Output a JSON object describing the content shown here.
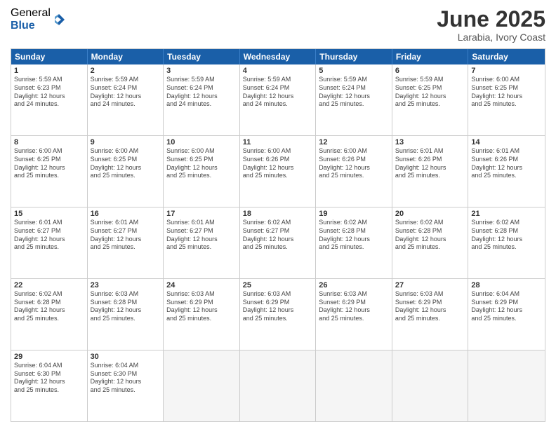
{
  "logo": {
    "general": "General",
    "blue": "Blue"
  },
  "title": "June 2025",
  "location": "Larabia, Ivory Coast",
  "days": [
    "Sunday",
    "Monday",
    "Tuesday",
    "Wednesday",
    "Thursday",
    "Friday",
    "Saturday"
  ],
  "rows": [
    [
      {
        "day": "1",
        "info": "Sunrise: 5:59 AM\nSunset: 6:23 PM\nDaylight: 12 hours\nand 24 minutes."
      },
      {
        "day": "2",
        "info": "Sunrise: 5:59 AM\nSunset: 6:24 PM\nDaylight: 12 hours\nand 24 minutes."
      },
      {
        "day": "3",
        "info": "Sunrise: 5:59 AM\nSunset: 6:24 PM\nDaylight: 12 hours\nand 24 minutes."
      },
      {
        "day": "4",
        "info": "Sunrise: 5:59 AM\nSunset: 6:24 PM\nDaylight: 12 hours\nand 24 minutes."
      },
      {
        "day": "5",
        "info": "Sunrise: 5:59 AM\nSunset: 6:24 PM\nDaylight: 12 hours\nand 25 minutes."
      },
      {
        "day": "6",
        "info": "Sunrise: 5:59 AM\nSunset: 6:25 PM\nDaylight: 12 hours\nand 25 minutes."
      },
      {
        "day": "7",
        "info": "Sunrise: 6:00 AM\nSunset: 6:25 PM\nDaylight: 12 hours\nand 25 minutes."
      }
    ],
    [
      {
        "day": "8",
        "info": "Sunrise: 6:00 AM\nSunset: 6:25 PM\nDaylight: 12 hours\nand 25 minutes."
      },
      {
        "day": "9",
        "info": "Sunrise: 6:00 AM\nSunset: 6:25 PM\nDaylight: 12 hours\nand 25 minutes."
      },
      {
        "day": "10",
        "info": "Sunrise: 6:00 AM\nSunset: 6:25 PM\nDaylight: 12 hours\nand 25 minutes."
      },
      {
        "day": "11",
        "info": "Sunrise: 6:00 AM\nSunset: 6:26 PM\nDaylight: 12 hours\nand 25 minutes."
      },
      {
        "day": "12",
        "info": "Sunrise: 6:00 AM\nSunset: 6:26 PM\nDaylight: 12 hours\nand 25 minutes."
      },
      {
        "day": "13",
        "info": "Sunrise: 6:01 AM\nSunset: 6:26 PM\nDaylight: 12 hours\nand 25 minutes."
      },
      {
        "day": "14",
        "info": "Sunrise: 6:01 AM\nSunset: 6:26 PM\nDaylight: 12 hours\nand 25 minutes."
      }
    ],
    [
      {
        "day": "15",
        "info": "Sunrise: 6:01 AM\nSunset: 6:27 PM\nDaylight: 12 hours\nand 25 minutes."
      },
      {
        "day": "16",
        "info": "Sunrise: 6:01 AM\nSunset: 6:27 PM\nDaylight: 12 hours\nand 25 minutes."
      },
      {
        "day": "17",
        "info": "Sunrise: 6:01 AM\nSunset: 6:27 PM\nDaylight: 12 hours\nand 25 minutes."
      },
      {
        "day": "18",
        "info": "Sunrise: 6:02 AM\nSunset: 6:27 PM\nDaylight: 12 hours\nand 25 minutes."
      },
      {
        "day": "19",
        "info": "Sunrise: 6:02 AM\nSunset: 6:28 PM\nDaylight: 12 hours\nand 25 minutes."
      },
      {
        "day": "20",
        "info": "Sunrise: 6:02 AM\nSunset: 6:28 PM\nDaylight: 12 hours\nand 25 minutes."
      },
      {
        "day": "21",
        "info": "Sunrise: 6:02 AM\nSunset: 6:28 PM\nDaylight: 12 hours\nand 25 minutes."
      }
    ],
    [
      {
        "day": "22",
        "info": "Sunrise: 6:02 AM\nSunset: 6:28 PM\nDaylight: 12 hours\nand 25 minutes."
      },
      {
        "day": "23",
        "info": "Sunrise: 6:03 AM\nSunset: 6:28 PM\nDaylight: 12 hours\nand 25 minutes."
      },
      {
        "day": "24",
        "info": "Sunrise: 6:03 AM\nSunset: 6:29 PM\nDaylight: 12 hours\nand 25 minutes."
      },
      {
        "day": "25",
        "info": "Sunrise: 6:03 AM\nSunset: 6:29 PM\nDaylight: 12 hours\nand 25 minutes."
      },
      {
        "day": "26",
        "info": "Sunrise: 6:03 AM\nSunset: 6:29 PM\nDaylight: 12 hours\nand 25 minutes."
      },
      {
        "day": "27",
        "info": "Sunrise: 6:03 AM\nSunset: 6:29 PM\nDaylight: 12 hours\nand 25 minutes."
      },
      {
        "day": "28",
        "info": "Sunrise: 6:04 AM\nSunset: 6:29 PM\nDaylight: 12 hours\nand 25 minutes."
      }
    ],
    [
      {
        "day": "29",
        "info": "Sunrise: 6:04 AM\nSunset: 6:30 PM\nDaylight: 12 hours\nand 25 minutes."
      },
      {
        "day": "30",
        "info": "Sunrise: 6:04 AM\nSunset: 6:30 PM\nDaylight: 12 hours\nand 25 minutes."
      },
      {
        "day": "",
        "info": ""
      },
      {
        "day": "",
        "info": ""
      },
      {
        "day": "",
        "info": ""
      },
      {
        "day": "",
        "info": ""
      },
      {
        "day": "",
        "info": ""
      }
    ]
  ]
}
